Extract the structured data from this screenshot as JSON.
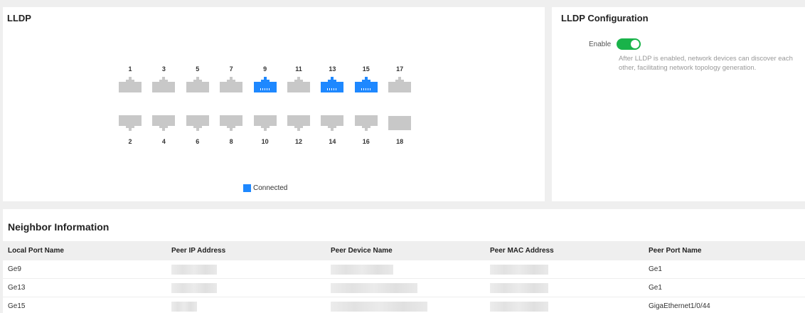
{
  "lldp": {
    "title": "LLDP",
    "ports_top": [
      {
        "label": "1",
        "connected": false
      },
      {
        "label": "3",
        "connected": false
      },
      {
        "label": "5",
        "connected": false
      },
      {
        "label": "7",
        "connected": false
      },
      {
        "label": "9",
        "connected": true
      },
      {
        "label": "11",
        "connected": false
      },
      {
        "label": "13",
        "connected": true
      },
      {
        "label": "15",
        "connected": true
      },
      {
        "label": "17",
        "connected": false
      }
    ],
    "ports_bottom": [
      {
        "label": "2",
        "connected": false
      },
      {
        "label": "4",
        "connected": false
      },
      {
        "label": "6",
        "connected": false
      },
      {
        "label": "8",
        "connected": false
      },
      {
        "label": "10",
        "connected": false
      },
      {
        "label": "12",
        "connected": false
      },
      {
        "label": "14",
        "connected": false
      },
      {
        "label": "16",
        "connected": false
      },
      {
        "label": "18",
        "connected": false,
        "type": "sfp"
      }
    ],
    "legend": {
      "label": "Connected",
      "color": "#1e88ff"
    }
  },
  "config": {
    "title": "LLDP Configuration",
    "enable_label": "Enable",
    "enabled": true,
    "toggle_color": "#19b34a",
    "description": "After LLDP is enabled, network devices can discover each other, facilitating network topology generation."
  },
  "neighbors": {
    "title": "Neighbor Information",
    "columns": [
      "Local Port Name",
      "Peer IP Address",
      "Peer Device Name",
      "Peer MAC Address",
      "Peer Port Name"
    ],
    "rows": [
      {
        "local_port": "Ge9",
        "peer_port": "Ge1"
      },
      {
        "local_port": "Ge13",
        "peer_port": "Ge1"
      },
      {
        "local_port": "Ge15",
        "peer_port": "GigaEthernet1/0/44"
      }
    ]
  },
  "colors": {
    "port_idle": "#c8c8c8",
    "port_connected": "#1e88ff"
  }
}
